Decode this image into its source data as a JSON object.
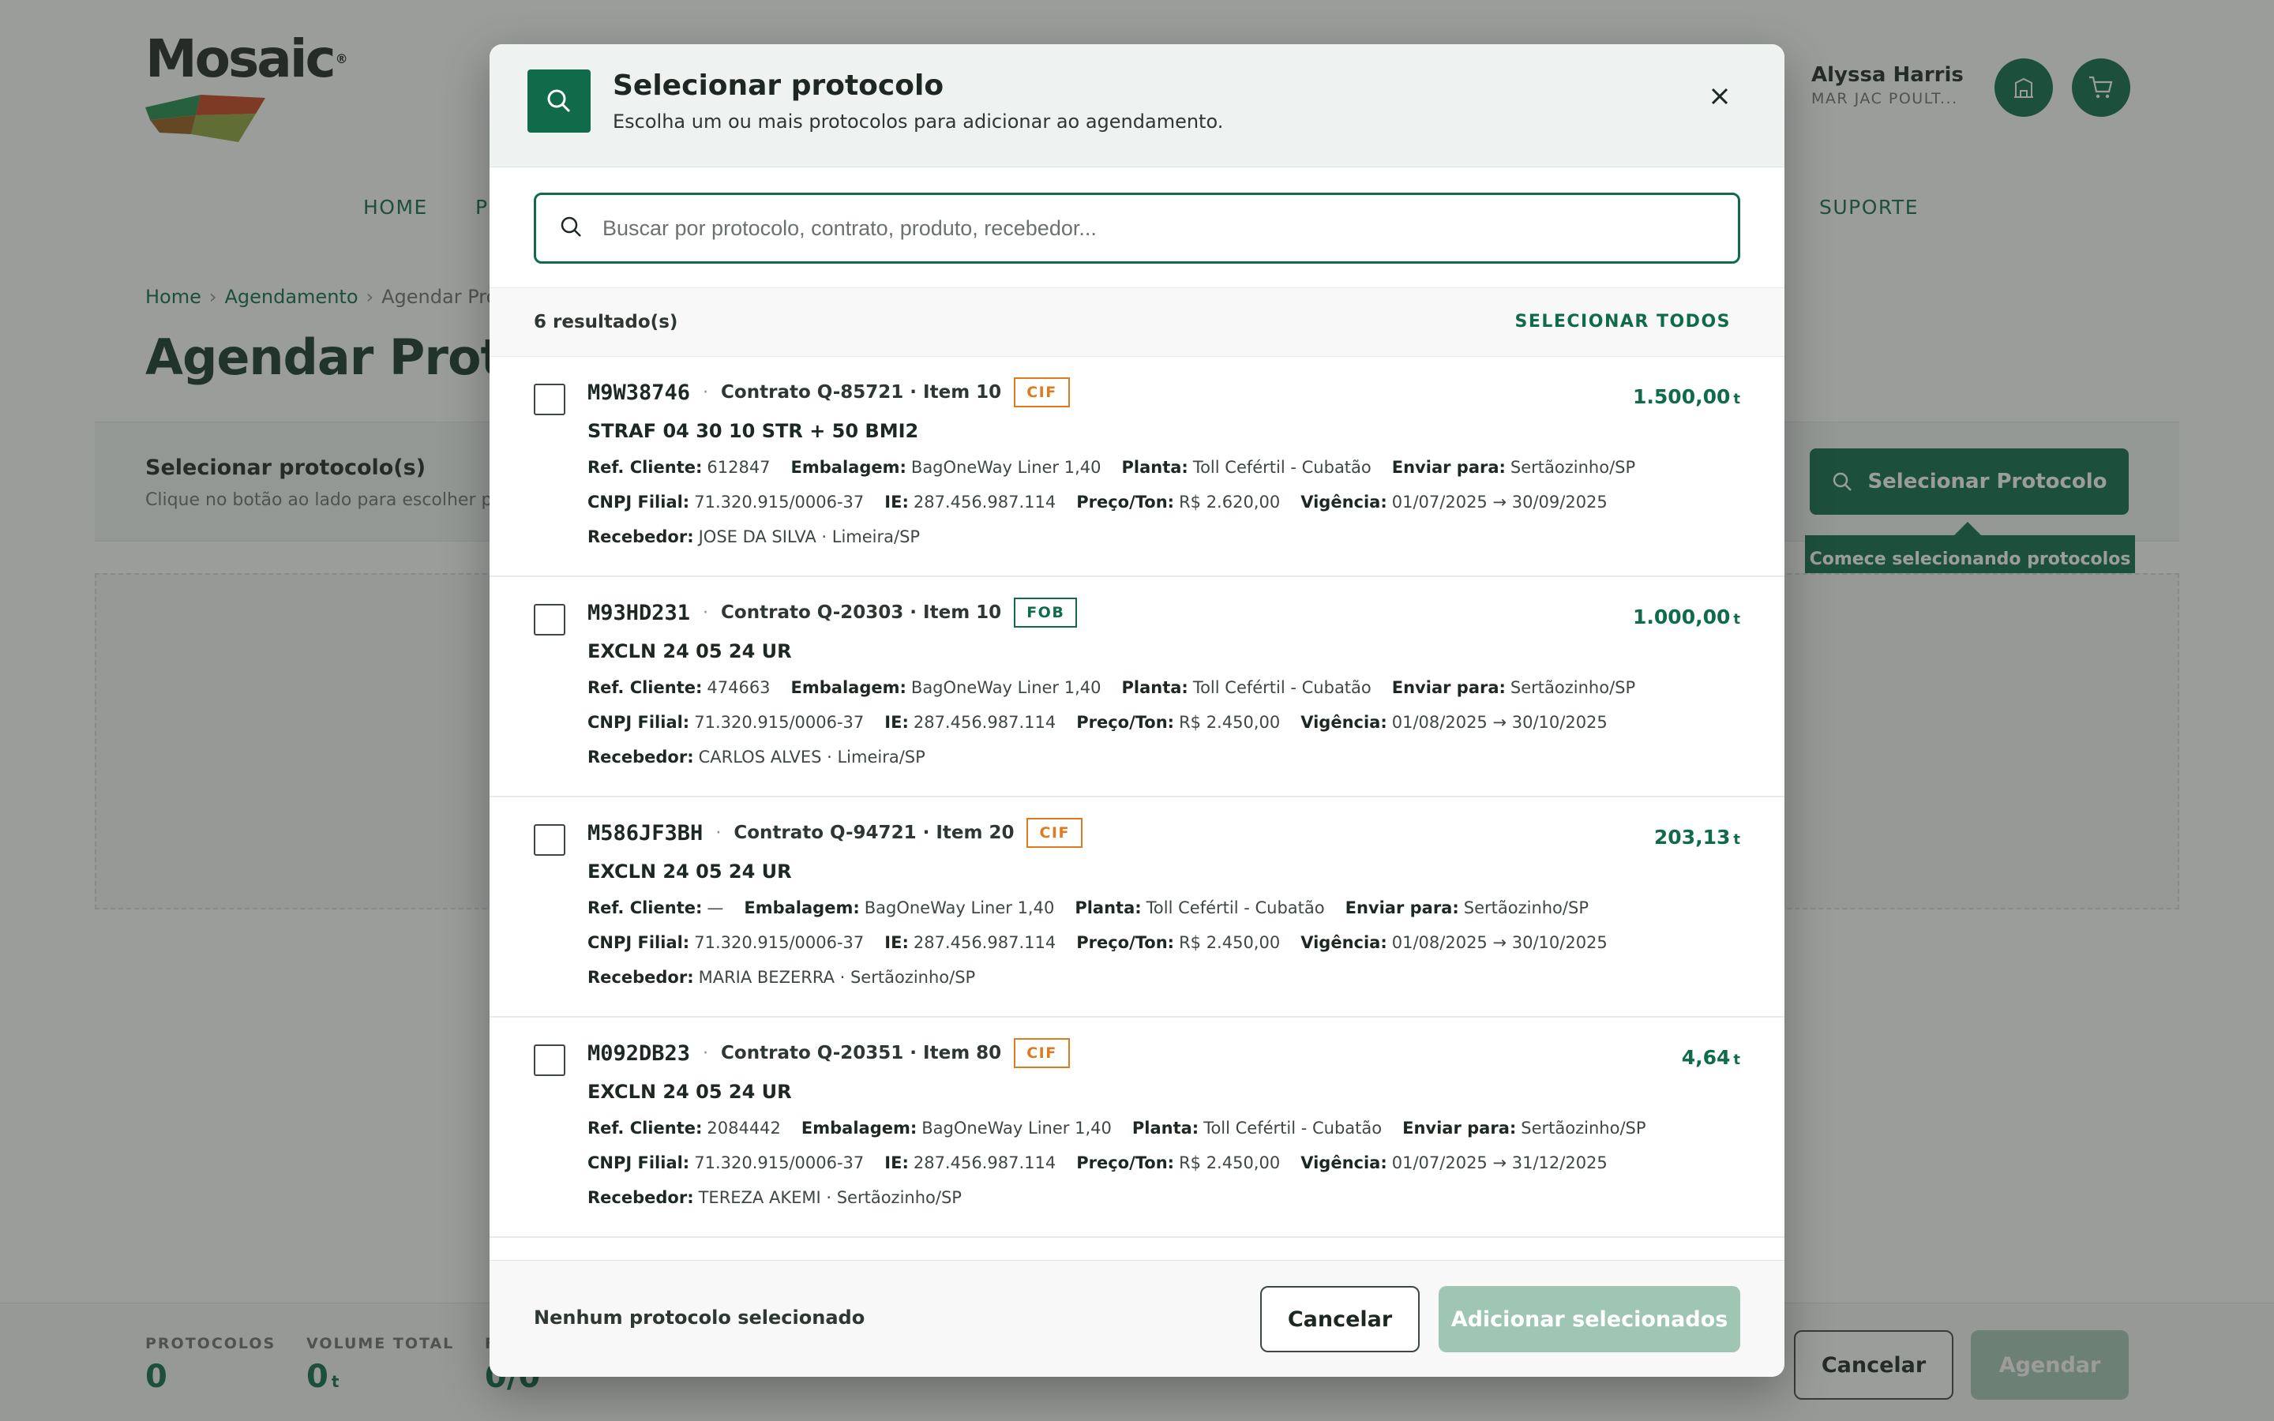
{
  "brand": {
    "name": "Mosaic",
    "accent": "#0f6b4a",
    "cif_color": "#e07a1f"
  },
  "user": {
    "name": "Alyssa Harris",
    "company": "MAR JAC POULT..."
  },
  "nav": {
    "items": [
      "HOME",
      "P",
      "SUPORTE"
    ]
  },
  "breadcrumb": {
    "home": "Home",
    "section": "Agendamento",
    "current": "Agendar Prot"
  },
  "page": {
    "title": "Agendar Protoc",
    "select_panel_title": "Selecionar protocolo(s)",
    "select_panel_sub": "Clique no botão ao lado para escolher prot",
    "select_protocol_button": "Selecionar Protocolo",
    "tooltip": "Comece selecionando protocolos"
  },
  "bottom_bar": {
    "protocols_label": "PROTOCOLOS",
    "protocols_value": "0",
    "volume_label": "VOLUME TOTAL",
    "volume_value": "0",
    "volume_unit": "t",
    "third_label": "F",
    "third_value": "0/0",
    "cancel": "Cancelar",
    "schedule": "Agendar"
  },
  "modal": {
    "title": "Selecionar protocolo",
    "subtitle": "Escolha um ou mais protocolos para adicionar ao agendamento.",
    "search_placeholder": "Buscar por protocolo, contrato, produto, recebedor...",
    "results_count": "6 resultado(s)",
    "select_all": "SELECIONAR TODOS",
    "footer_status": "Nenhum protocolo selecionado",
    "cancel": "Cancelar",
    "add_selected": "Adicionar selecionados",
    "labels": {
      "ref": "Ref. Cliente:",
      "embalagem": "Embalagem:",
      "planta": "Planta:",
      "enviar": "Enviar para:",
      "cnpj": "CNPJ Filial:",
      "ie": "IE:",
      "preco": "Preço/Ton:",
      "vigencia": "Vigência:",
      "recebedor": "Recebedor:"
    },
    "items": [
      {
        "code": "M9W38746",
        "contract": "Contrato Q-85721 · Item 10",
        "tag": "CIF",
        "qty": "1.500,00",
        "unit": "t",
        "product": "STRAF 04 30 10 STR + 50 BMI2",
        "ref": "612847",
        "embalagem": "BagOneWay Liner 1,40",
        "planta": "Toll Cefértil - Cubatão",
        "enviar": "Sertãozinho/SP",
        "cnpj": "71.320.915/0006-37",
        "ie": "287.456.987.114",
        "preco": "R$ 2.620,00",
        "vigencia": "01/07/2025 → 30/09/2025",
        "recebedor": "JOSE DA SILVA · Limeira/SP"
      },
      {
        "code": "M93HD231",
        "contract": "Contrato Q-20303 · Item 10",
        "tag": "FOB",
        "qty": "1.000,00",
        "unit": "t",
        "product": "EXCLN 24 05 24 UR",
        "ref": "474663",
        "embalagem": "BagOneWay Liner 1,40",
        "planta": "Toll Cefértil - Cubatão",
        "enviar": "Sertãozinho/SP",
        "cnpj": "71.320.915/0006-37",
        "ie": "287.456.987.114",
        "preco": "R$ 2.450,00",
        "vigencia": "01/08/2025 → 30/10/2025",
        "recebedor": "CARLOS ALVES · Limeira/SP"
      },
      {
        "code": "M586JF3BH",
        "contract": "Contrato Q-94721 · Item 20",
        "tag": "CIF",
        "qty": "203,13",
        "unit": "t",
        "product": "EXCLN 24 05 24 UR",
        "ref": "—",
        "embalagem": "BagOneWay Liner 1,40",
        "planta": "Toll Cefértil - Cubatão",
        "enviar": "Sertãozinho/SP",
        "cnpj": "71.320.915/0006-37",
        "ie": "287.456.987.114",
        "preco": "R$ 2.450,00",
        "vigencia": "01/08/2025 → 30/10/2025",
        "recebedor": "MARIA BEZERRA · Sertãozinho/SP"
      },
      {
        "code": "M092DB23",
        "contract": "Contrato Q-20351 · Item 80",
        "tag": "CIF",
        "qty": "4,64",
        "unit": "t",
        "product": "EXCLN 24 05 24 UR",
        "ref": "2084442",
        "embalagem": "BagOneWay Liner 1,40",
        "planta": "Toll Cefértil - Cubatão",
        "enviar": "Sertãozinho/SP",
        "cnpj": "71.320.915/0006-37",
        "ie": "287.456.987.114",
        "preco": "R$ 2.450,00",
        "vigencia": "01/07/2025 → 31/12/2025",
        "recebedor": "TEREZA AKEMI · Sertãozinho/SP"
      }
    ]
  }
}
